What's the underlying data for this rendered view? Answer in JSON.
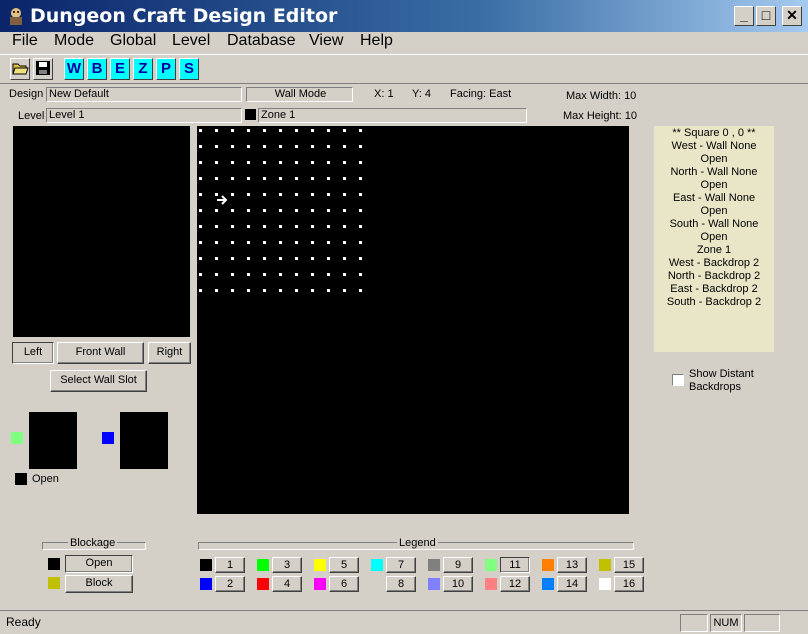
{
  "window": {
    "title": "Dungeon Craft Design Editor",
    "minimize": "_",
    "maximize": "□",
    "close": "✕"
  },
  "menu": [
    "File",
    "Mode",
    "Global",
    "Level",
    "Database",
    "View",
    "Help"
  ],
  "toolbar": {
    "modes": [
      "W",
      "B",
      "E",
      "Z",
      "P",
      "S"
    ]
  },
  "header": {
    "design_label": "Design",
    "design_value": "New Default",
    "level_label": "Level",
    "level_value": "Level 1",
    "mode_value": "Wall Mode",
    "x_text": "X: 1",
    "y_text": "Y: 4",
    "facing_text": "Facing: East",
    "zone_value": "Zone 1",
    "max_width": "Max Width: 10",
    "max_height": "Max Height: 10"
  },
  "wall_buttons": {
    "left": "Left",
    "front": "Front Wall",
    "right": "Right",
    "select_slot": "Select Wall Slot"
  },
  "open_label": "Open",
  "info_lines": [
    "** Square 0 , 0 **",
    "West - Wall None",
    "Open",
    "North - Wall None",
    "Open",
    "East - Wall None",
    "Open",
    "South - Wall None",
    "Open",
    "Zone 1",
    "West - Backdrop 2",
    "North - Backdrop 2",
    "East - Backdrop 2",
    "South - Backdrop 2"
  ],
  "show_distant": "Show Distant Backdrops",
  "blockage": {
    "title": "Blockage",
    "open": "Open",
    "block": "Block"
  },
  "legend": {
    "title": "Legend",
    "items": [
      {
        "n": "1",
        "color": "#000000"
      },
      {
        "n": "2",
        "color": "#0000ff"
      },
      {
        "n": "3",
        "color": "#00ff00"
      },
      {
        "n": "4",
        "color": "#ff0000"
      },
      {
        "n": "5",
        "color": "#ffff00"
      },
      {
        "n": "6",
        "color": "#ff00ff"
      },
      {
        "n": "7",
        "color": "#00ffff"
      },
      {
        "n": "8",
        "color": "#d4d0c8"
      },
      {
        "n": "9",
        "color": "#808080"
      },
      {
        "n": "10",
        "color": "#8080ff"
      },
      {
        "n": "11",
        "color": "#80ff80"
      },
      {
        "n": "12",
        "color": "#ff8080"
      },
      {
        "n": "13",
        "color": "#ff8000"
      },
      {
        "n": "14",
        "color": "#0080ff"
      },
      {
        "n": "15",
        "color": "#c0c000"
      },
      {
        "n": "16",
        "color": "#ffffff"
      }
    ]
  },
  "status": {
    "text": "Ready",
    "num": "NUM"
  },
  "colors": {
    "swatch_green": "#80ff80",
    "swatch_blue": "#0000ff",
    "block_color": "#c0c000"
  }
}
